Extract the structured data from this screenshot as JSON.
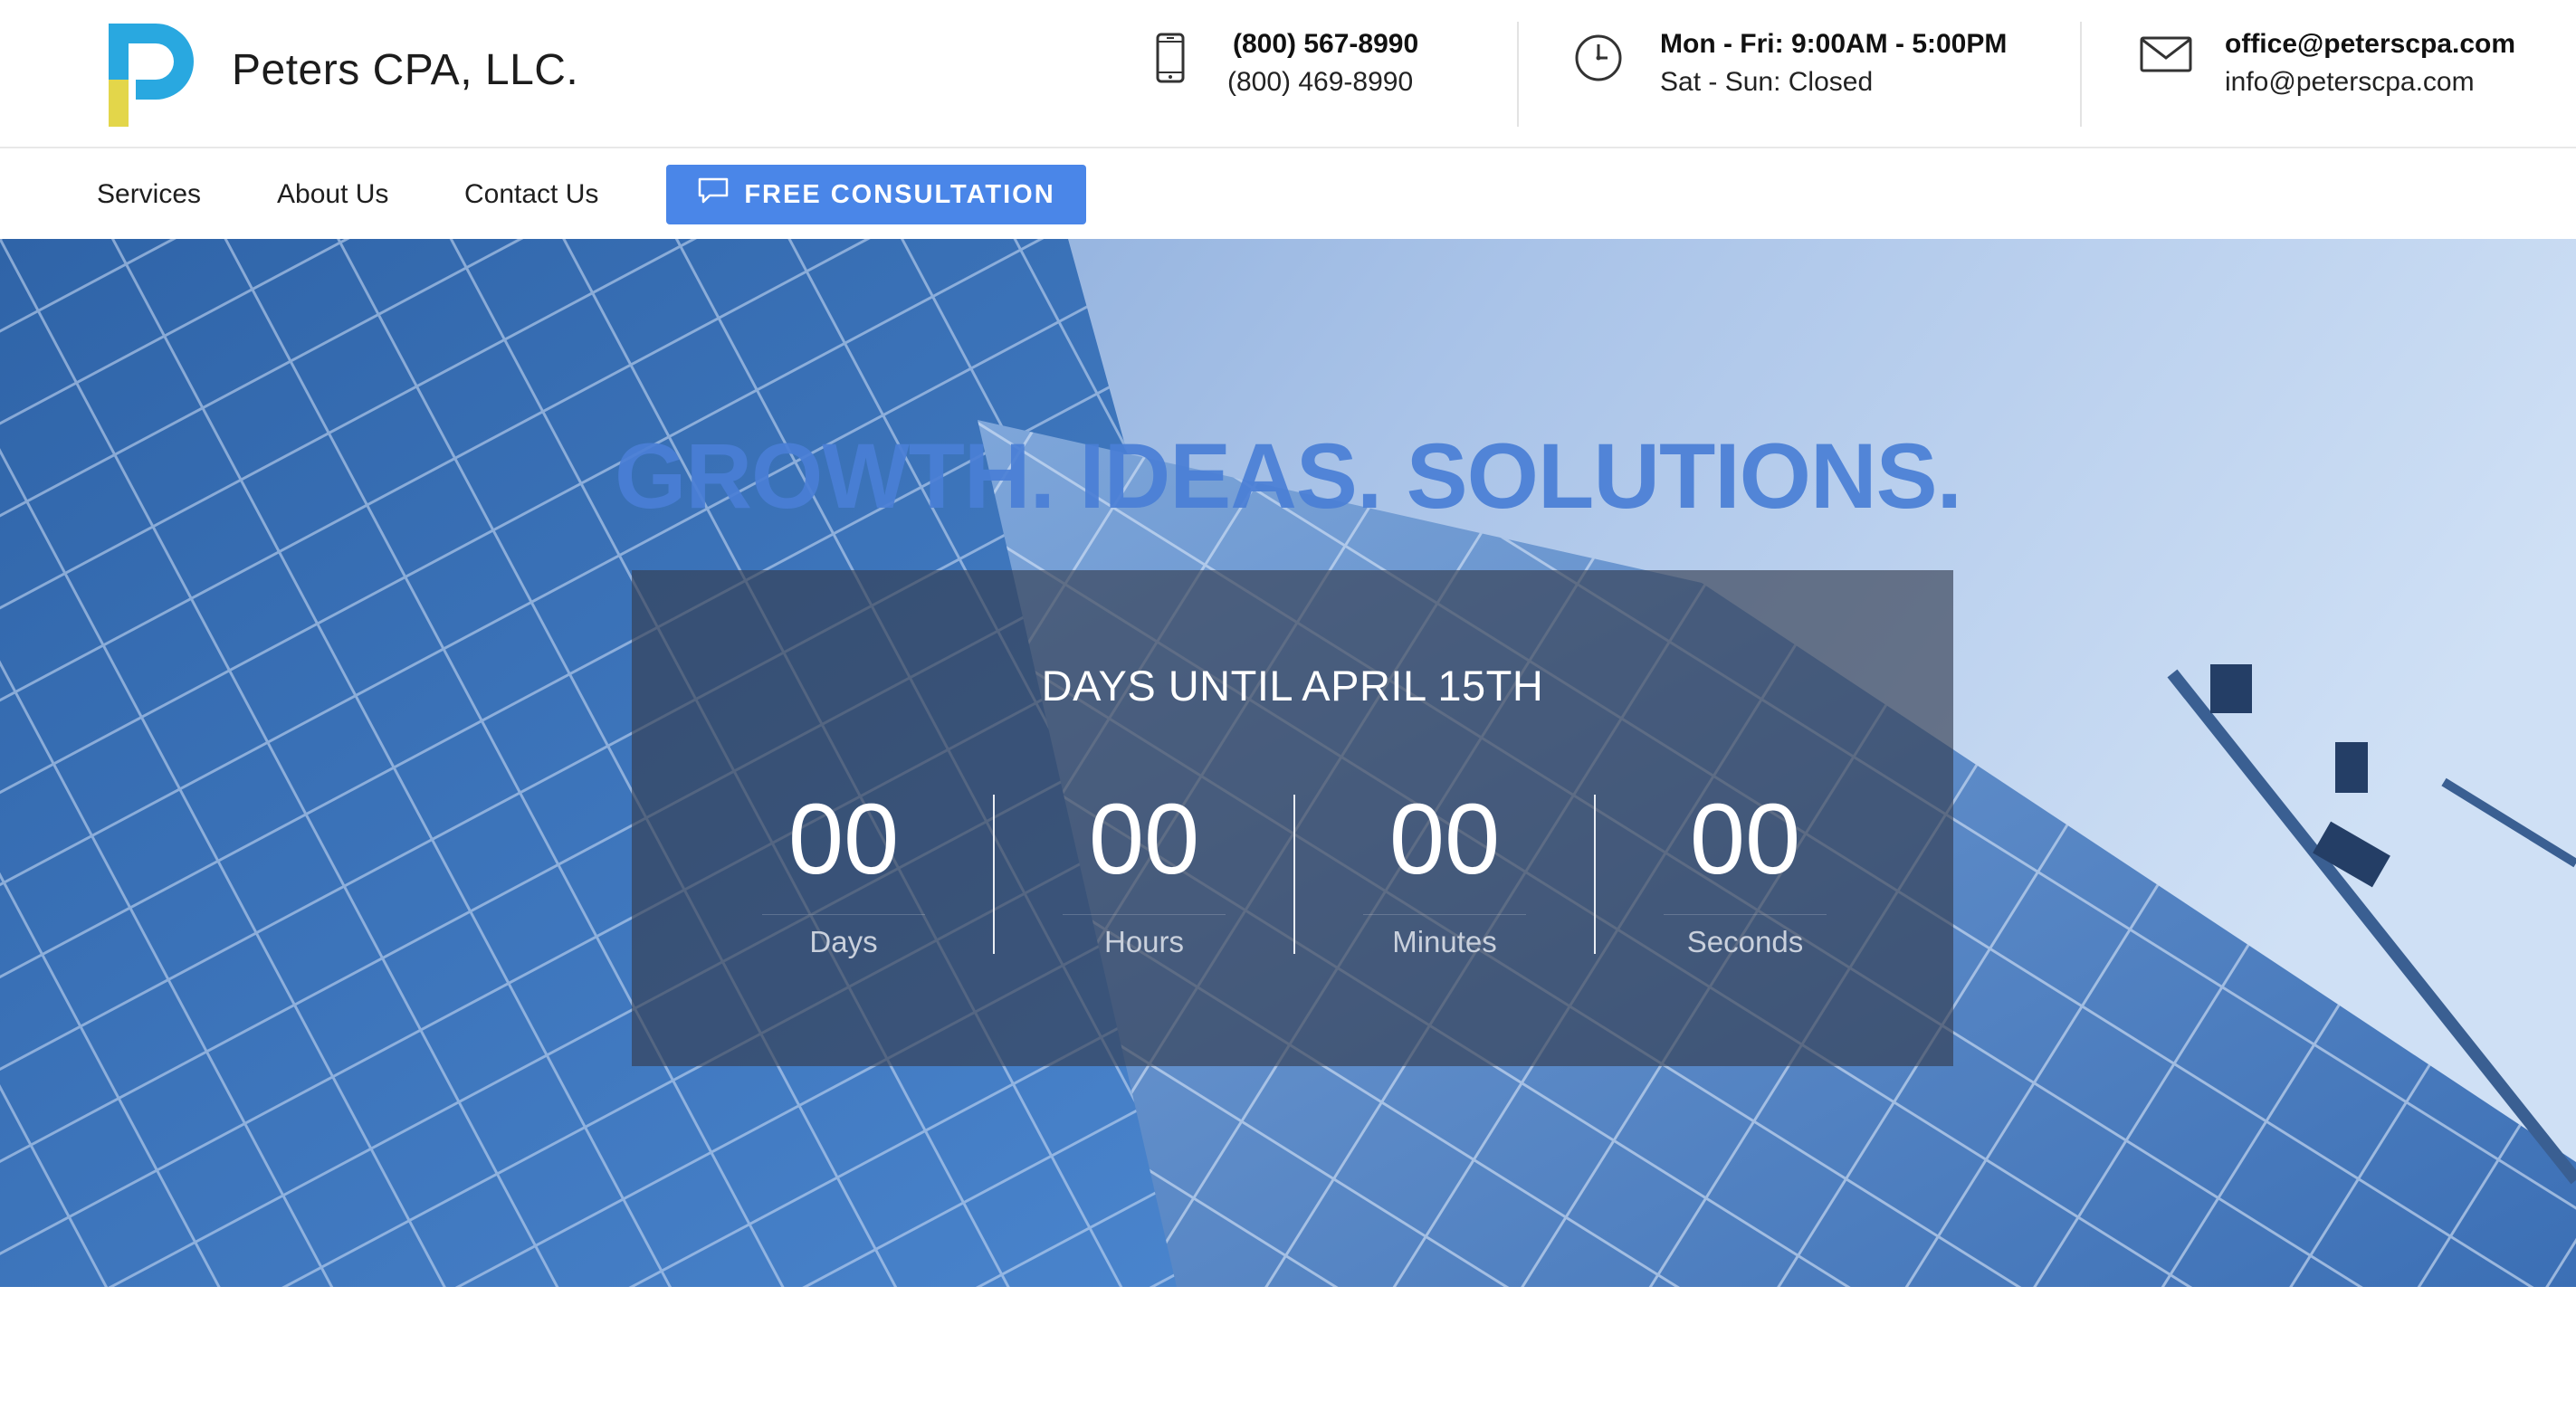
{
  "header": {
    "brand_name": "Peters CPA, LLC.",
    "logo_icon": "peters-p-logo",
    "phone": {
      "icon": "mobile-phone-icon",
      "primary": "(800) 567-8990",
      "secondary": "(800) 469-8990"
    },
    "hours": {
      "icon": "clock-icon",
      "weekdays": "Mon - Fri: 9:00AM - 5:00PM",
      "weekend": "Sat - Sun: Closed"
    },
    "email": {
      "icon": "envelope-icon",
      "primary": "office@peterscpa.com",
      "secondary": "info@peterscpa.com"
    }
  },
  "nav": {
    "items": [
      {
        "label": "Services"
      },
      {
        "label": "About Us"
      },
      {
        "label": "Contact Us"
      }
    ],
    "cta": {
      "label": "FREE CONSULTATION",
      "icon": "chat-bubble-icon"
    }
  },
  "hero": {
    "headline": "GROWTH. IDEAS. SOLUTIONS.",
    "countdown": {
      "title": "DAYS UNTIL APRIL 15TH",
      "units": [
        {
          "value": "00",
          "label": "Days"
        },
        {
          "value": "00",
          "label": "Hours"
        },
        {
          "value": "00",
          "label": "Minutes"
        },
        {
          "value": "00",
          "label": "Seconds"
        }
      ]
    }
  },
  "colors": {
    "accent": "#4a86e8",
    "headline": "#4a7fd6",
    "logo_blue": "#29a8e0",
    "logo_yellow": "#e3d64a",
    "countdown_panel": "#353e52"
  }
}
